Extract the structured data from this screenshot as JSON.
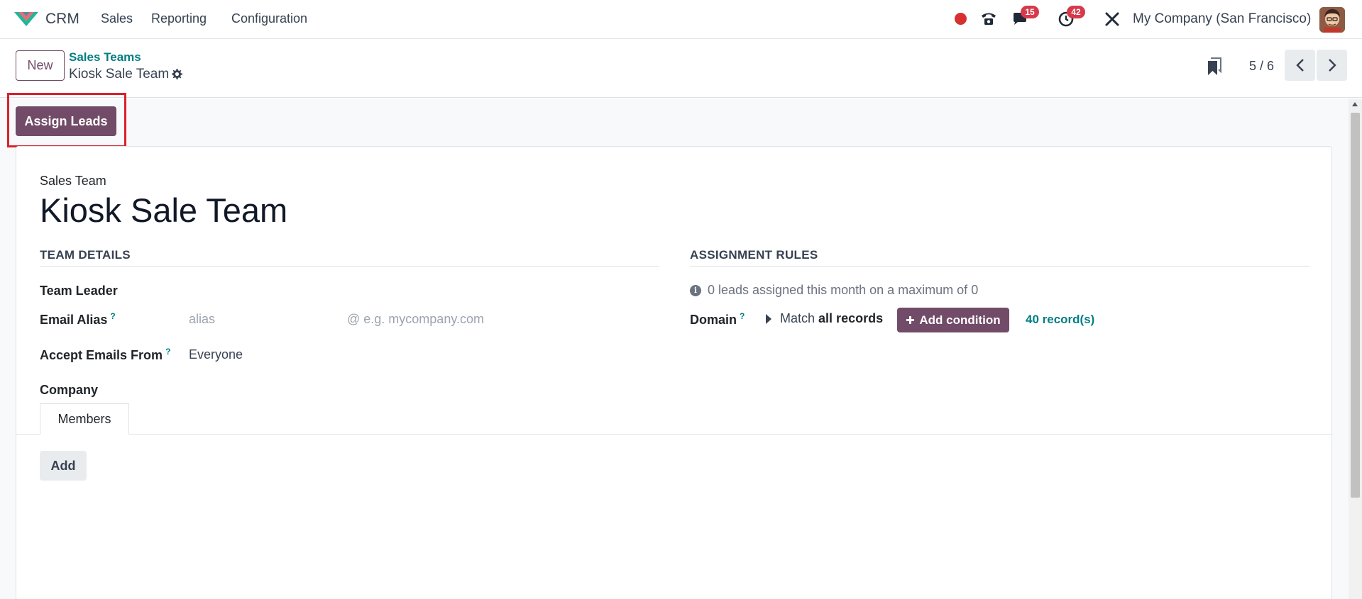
{
  "navbar": {
    "app_name": "CRM",
    "menu": [
      "Sales",
      "Reporting",
      "Configuration"
    ],
    "messages_badge": "15",
    "activities_badge": "42",
    "company": "My Company (San Francisco)"
  },
  "control_panel": {
    "new_label": "New",
    "breadcrumb_parent": "Sales Teams",
    "breadcrumb_current": "Kiosk Sale Team",
    "pager": "5 / 6"
  },
  "status_bar": {
    "assign_leads_label": "Assign Leads"
  },
  "form": {
    "record_label": "Sales Team",
    "record_name": "Kiosk Sale Team",
    "team_details": {
      "header": "TEAM DETAILS",
      "team_leader_label": "Team Leader",
      "email_alias_label": "Email Alias",
      "email_alias_placeholder": "alias",
      "email_domain_placeholder": "@ e.g. mycompany.com",
      "accept_emails_label": "Accept Emails From",
      "accept_emails_value": "Everyone",
      "company_label": "Company",
      "help_mark": "?"
    },
    "assignment_rules": {
      "header": "ASSIGNMENT RULES",
      "info_text": "0 leads assigned this month on a maximum of 0",
      "domain_label": "Domain",
      "match_prefix": "Match",
      "match_bold": "all records",
      "add_condition_label": "Add condition",
      "records_count": "40 record(s)"
    },
    "tabs": [
      "Members"
    ],
    "add_label": "Add"
  },
  "colors": {
    "primary": "#714b67",
    "link": "#017e84",
    "badge": "#d63a4a",
    "highlight": "#d9212c"
  }
}
